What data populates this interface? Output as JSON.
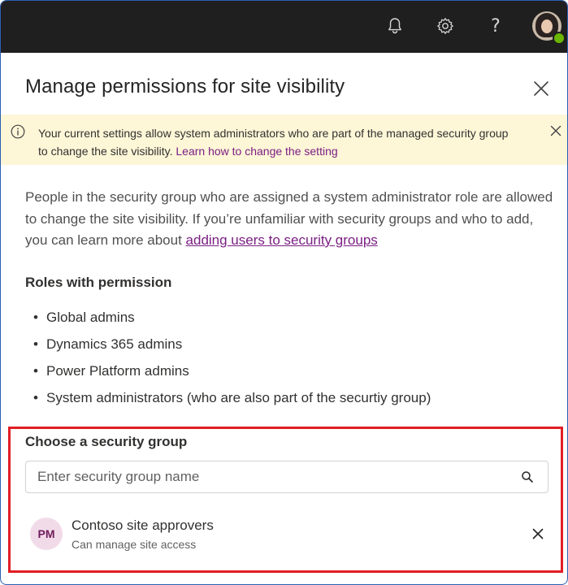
{
  "header": {
    "icons": [
      "bell-icon",
      "gear-icon",
      "help-icon",
      "avatar"
    ],
    "help_glyph": "?",
    "presence_color": "#6bb700"
  },
  "panel": {
    "title": "Manage permissions for site visibility"
  },
  "banner": {
    "text": "Your current settings allow system administrators who are part of the managed security group to change the site visibility.",
    "link": "Learn how to change the setting",
    "bg_color": "#fdf6d7"
  },
  "description": {
    "text": "People in the security group who are assigned a system administrator role are allowed to change the site visibility. If you’re unfamiliar with security groups and who to add, you can learn more about",
    "link": "adding users to security groups"
  },
  "roles": {
    "title": "Roles with permission",
    "items": [
      "Global admins",
      "Dynamics 365 admins",
      "Power Platform admins",
      "System administrators (who are also part of the securtiy group)"
    ]
  },
  "security_group": {
    "label": "Choose a security group",
    "placeholder": "Enter security group name",
    "selected": {
      "initials": "PM",
      "name": "Contoso site approvers",
      "subtitle": "Can manage site access"
    },
    "highlight_color": "#e11d24"
  }
}
